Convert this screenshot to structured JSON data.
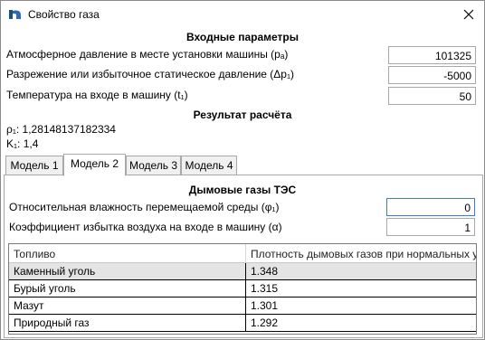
{
  "window": {
    "title": "Свойство газа"
  },
  "input_section": {
    "title": "Входные параметры",
    "fields": [
      {
        "label": "Атмосферное давление в месте установки машины (pₐ)",
        "value": "101325"
      },
      {
        "label": "Разрежение или избыточное статическое давление (Δp₁)",
        "value": "-5000"
      },
      {
        "label": "Температура на входе в машину (t₁)",
        "value": "50"
      }
    ]
  },
  "result_section": {
    "title": "Результат расчёта",
    "lines": [
      "ρ₁: 1,28148137182334",
      "K₁: 1,4"
    ]
  },
  "tabs": [
    {
      "label": "Модель 1",
      "active": false
    },
    {
      "label": "Модель 2",
      "active": true
    },
    {
      "label": "Модель 3",
      "active": false
    },
    {
      "label": "Модель 4",
      "active": false
    }
  ],
  "model2": {
    "title": "Дымовые газы ТЭС",
    "fields": [
      {
        "label": "Относительная влажность перемещаемой среды (φ₁)",
        "value": "0"
      },
      {
        "label": "Коэффициент избытка воздуха на входе в машину (α)",
        "value": "1"
      }
    ],
    "table": {
      "columns": [
        "Топливо",
        "Плотность дымовых газов при нормальных условиях"
      ],
      "rows": [
        [
          "Каменный уголь",
          "1.348"
        ],
        [
          "Бурый уголь",
          "1.315"
        ],
        [
          "Мазут",
          "1.301"
        ],
        [
          "Природный газ",
          "1.292"
        ]
      ]
    }
  },
  "colors": {
    "accent": "#3a7bd5",
    "icon": "#1f4e79",
    "selected_row": "#e4e4e4"
  }
}
